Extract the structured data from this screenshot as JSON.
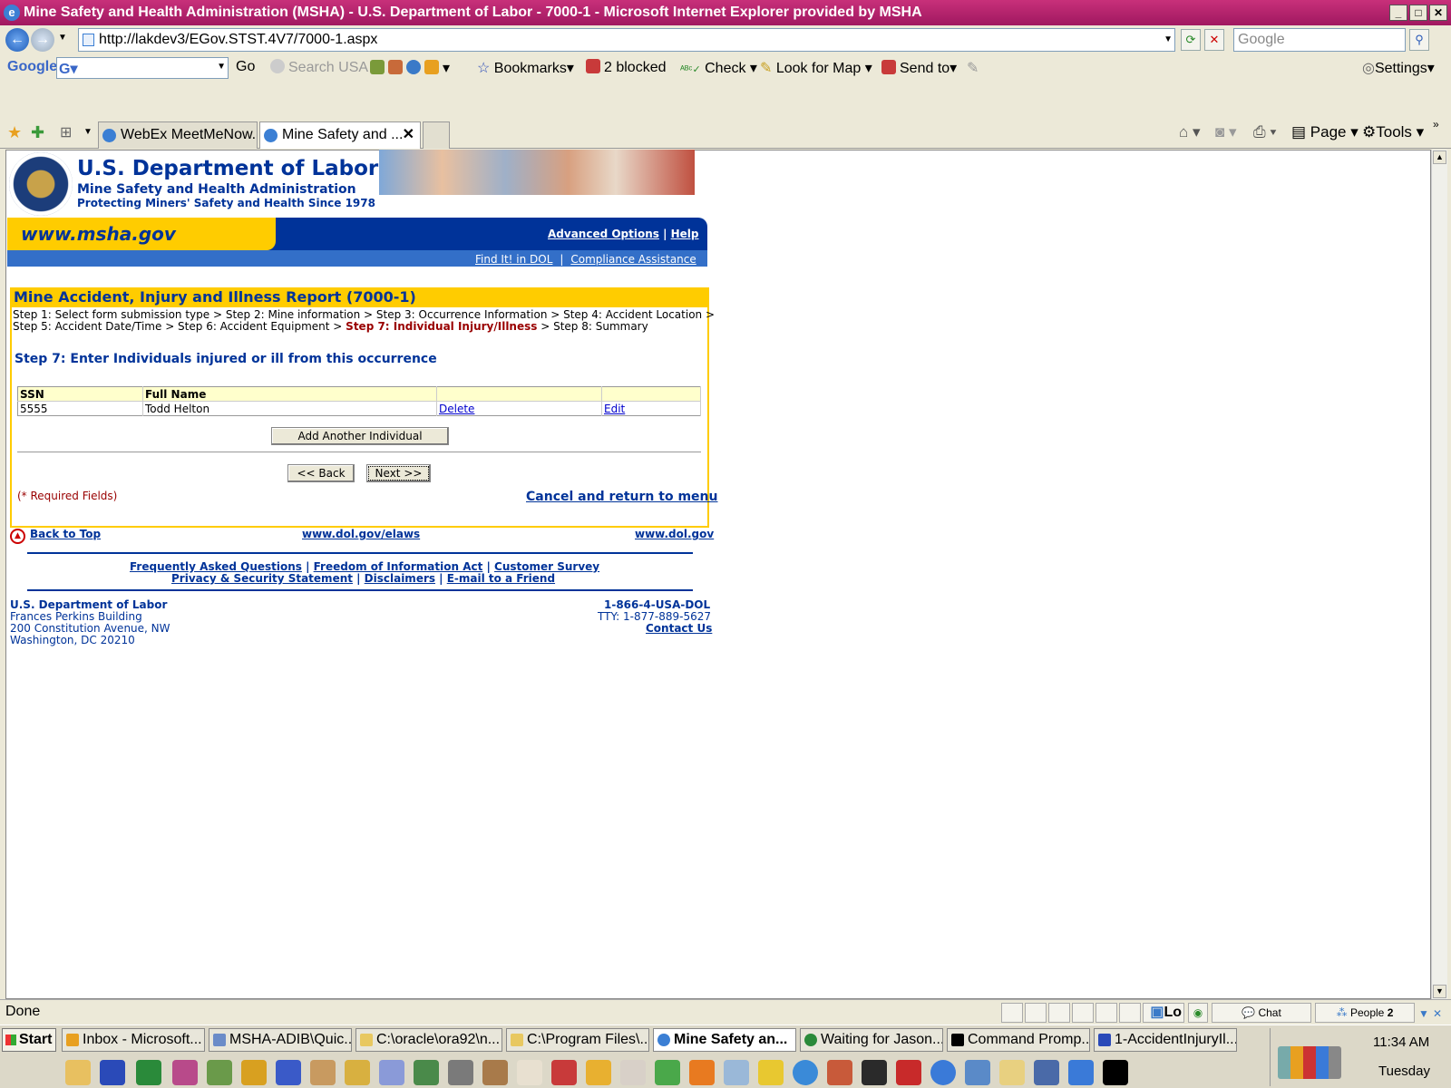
{
  "window": {
    "title": "Mine Safety and Health Administration (MSHA) - U.S. Department of Labor - 7000-1 - Microsoft Internet Explorer provided by MSHA"
  },
  "address_bar": {
    "url": "http://lakdev3/EGov.STST.4V7/7000-1.aspx",
    "search_placeholder": "Google"
  },
  "google_toolbar": {
    "logo": "Google",
    "go": "Go",
    "search_usa": "Search USA",
    "bookmarks": "Bookmarks",
    "blocked": "2 blocked",
    "check": "Check",
    "look_for_map": "Look for Map",
    "send_to": "Send to",
    "settings": "Settings"
  },
  "tabs": [
    {
      "label": "WebEx MeetMeNow..."
    },
    {
      "label": "Mine Safety and ..."
    }
  ],
  "command_bar": {
    "page": "Page",
    "tools": "Tools"
  },
  "header": {
    "title": "U.S. Department of Labor",
    "subtitle1": "Mine Safety and Health Administration",
    "subtitle2": "Protecting Miners' Safety and Health Since 1978",
    "site_url": "www.msha.gov",
    "advanced_options": "Advanced Options",
    "help": "Help",
    "find_it": "Find It! in DOL",
    "compliance": "Compliance Assistance"
  },
  "form": {
    "heading": "Mine Accident, Injury and Illness Report (7000-1)",
    "steps_line1": "Step 1: Select form submission type > Step 2: Mine information > Step 3: Occurrence Information > Step 4: Accident Location >",
    "steps_line2_pre": "Step 5: Accident Date/Time > Step 6: Accident Equipment > ",
    "steps_line2_current": "Step 7: Individual Injury/Illness",
    "steps_line2_post": " > Step 8: Summary",
    "step_title": "Step 7: Enter Individuals injured or ill from this occurrence",
    "table": {
      "headers": [
        "SSN",
        "Full Name",
        "",
        ""
      ],
      "rows": [
        {
          "ssn": "5555",
          "name": "Todd Helton",
          "delete": "Delete",
          "edit": "Edit"
        }
      ]
    },
    "add_button": "Add Another Individual",
    "back_button": "<< Back",
    "next_button": "Next >>",
    "required_note": "(* Required Fields)",
    "cancel_link": "Cancel and return to menu"
  },
  "footer": {
    "back_to_top": "Back to Top",
    "elaws": "www.dol.gov/elaws",
    "dol": "www.dol.gov",
    "faq": "Frequently Asked Questions",
    "foia": "Freedom of Information Act",
    "survey": "Customer Survey",
    "privacy": "Privacy & Security Statement",
    "disclaimers": "Disclaimers",
    "email": "E-mail to a Friend",
    "org": "U.S. Department of Labor",
    "building": "Frances Perkins Building",
    "street": "200 Constitution Avenue, NW",
    "city": "Washington, DC 20210",
    "phone": "1-866-4-USA-DOL",
    "tty": "TTY: 1-877-889-5627",
    "contact": "Contact Us"
  },
  "status_bar": {
    "text": "Done",
    "lo": "Lo",
    "chat": "Chat",
    "people": "People",
    "people_count": "2"
  },
  "taskbar": {
    "start": "Start",
    "items": [
      {
        "label": "Inbox - Microsoft..."
      },
      {
        "label": "MSHA-ADIB\\Quic..."
      },
      {
        "label": "C:\\oracle\\ora92\\n..."
      },
      {
        "label": "C:\\Program Files\\..."
      },
      {
        "label": "Mine Safety an..."
      },
      {
        "label": "Waiting for Jason..."
      },
      {
        "label": "Command Promp..."
      },
      {
        "label": "1-AccidentInjuryIl..."
      }
    ],
    "time": "11:34 AM",
    "day": "Tuesday"
  }
}
